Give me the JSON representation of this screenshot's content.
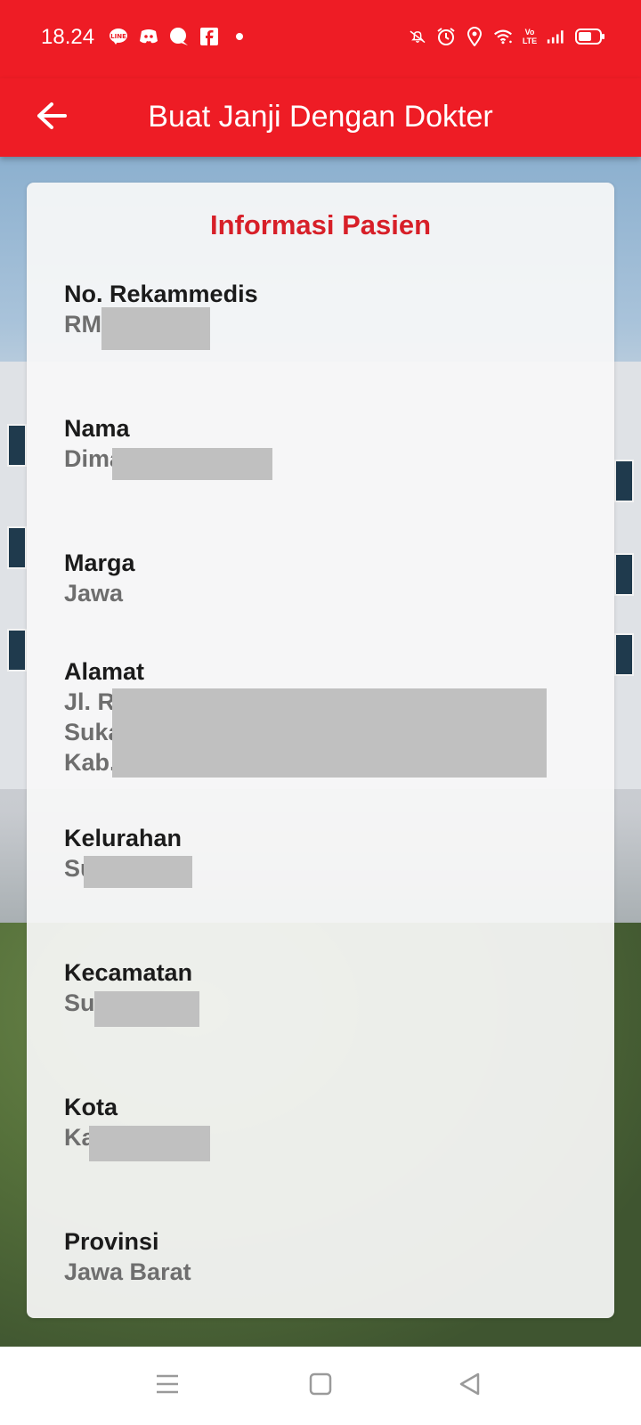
{
  "status_bar": {
    "time": "18.24",
    "left_icons": [
      "line-icon",
      "discord-icon",
      "chat-bubble-icon",
      "facebook-icon",
      "dot-icon"
    ],
    "right_icons": [
      "mute-icon",
      "alarm-icon",
      "location-icon",
      "wifi-icon",
      "volte-icon",
      "signal-icon",
      "battery-icon"
    ],
    "volte_text": "Vo LTE"
  },
  "app_bar": {
    "title": "Buat Janji Dengan Dokter",
    "back_icon": "arrow-left-icon"
  },
  "card": {
    "title": "Informasi Pasien",
    "fields": [
      {
        "label": "No. Rekammedis",
        "value": "RM"
      },
      {
        "label": "Nama",
        "value": "Dima"
      },
      {
        "label": "Marga",
        "value": "Jawa"
      },
      {
        "label": "Alamat",
        "value": "Jl. R\nSuka\nKab."
      },
      {
        "label": "Kelurahan",
        "value": "Su"
      },
      {
        "label": "Kecamatan",
        "value": "Su"
      },
      {
        "label": "Kota",
        "value": "Ka"
      },
      {
        "label": "Provinsi",
        "value": "Jawa Barat"
      }
    ]
  },
  "nav_bar": {
    "icons": [
      "menu-icon",
      "home-square-icon",
      "back-triangle-icon"
    ]
  },
  "colors": {
    "brand_red": "#ee1c25",
    "title_red": "#d71f28",
    "label": "#1b1b1b",
    "value": "#6e6e6e"
  }
}
